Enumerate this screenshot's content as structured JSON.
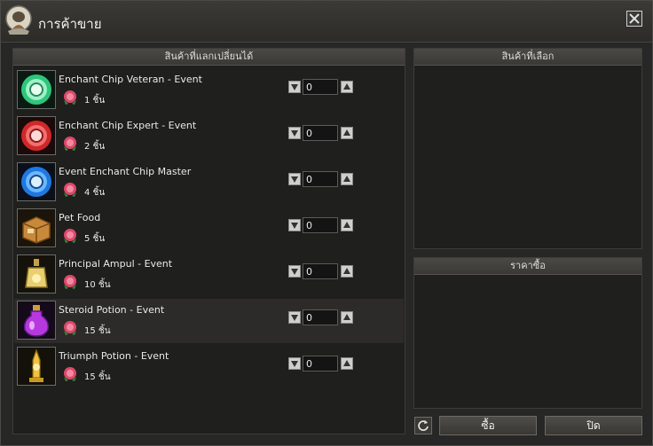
{
  "window": {
    "title": "การค้าขาย"
  },
  "left_panel": {
    "header": "สินค้าที่แลกเปลี่ยนได้"
  },
  "items": [
    {
      "name": "Enchant Chip Veteran - Event",
      "price": "1 ชิ้น",
      "qty": "0",
      "icon": "green-enchant-chip-icon",
      "color": "#3fd08a"
    },
    {
      "name": "Enchant Chip Expert - Event",
      "price": "2 ชิ้น",
      "qty": "0",
      "icon": "red-enchant-chip-icon",
      "color": "#e23a3a"
    },
    {
      "name": "Event Enchant Chip Master",
      "price": "4 ชิ้น",
      "qty": "0",
      "icon": "blue-enchant-chip-icon",
      "color": "#2f8ef0"
    },
    {
      "name": "Pet Food",
      "price": "5 ชิ้น",
      "qty": "0",
      "icon": "pet-food-box-icon",
      "color": "#d89a3a"
    },
    {
      "name": "Principal Ampul - Event",
      "price": "10 ชิ้น",
      "qty": "0",
      "icon": "ampul-bottle-icon",
      "color": "#e0c050"
    },
    {
      "name": "Steroid Potion - Event",
      "price": "15 ชิ้น",
      "qty": "0",
      "icon": "purple-potion-icon",
      "color": "#c040e0"
    },
    {
      "name": "Triumph Potion - Event",
      "price": "15 ชิ้น",
      "qty": "0",
      "icon": "gold-potion-icon",
      "color": "#f0c040"
    }
  ],
  "right_panel": {
    "selected_header": "สินค้าที่เลือก",
    "price_header": "ราคาซื้อ"
  },
  "buttons": {
    "buy": "ซื้อ",
    "close": "ปิด"
  }
}
